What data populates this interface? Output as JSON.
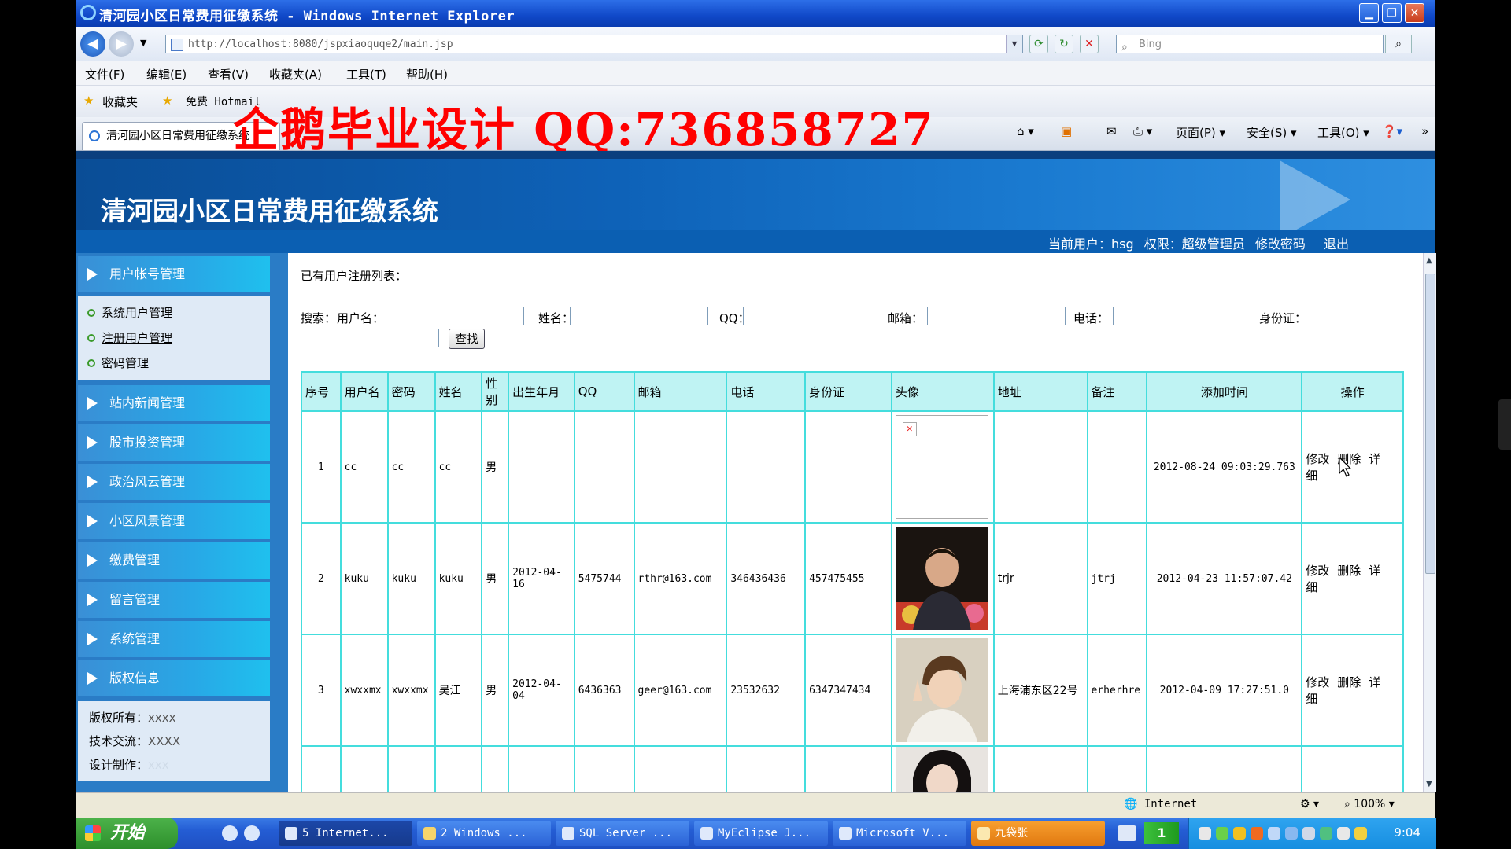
{
  "window": {
    "title": "清河园小区日常费用征缴系统 - Windows Internet Explorer"
  },
  "address": {
    "url": "http://localhost:8080/jspxiaoquqe2/main.jsp",
    "search_placeholder": "Bing"
  },
  "menu": [
    "文件(F)",
    "编辑(E)",
    "查看(V)",
    "收藏夹(A)",
    "工具(T)",
    "帮助(H)"
  ],
  "favbar": {
    "favorites": "收藏夹",
    "free_hotmail": "免费 Hotmail",
    "watermark": "企鹅毕业设计 QQ:736858727"
  },
  "tab": {
    "label": "清河园小区日常费用征缴系统"
  },
  "commandbar": {
    "page": "页面(P)",
    "safety": "安全(S)",
    "tools": "工具(O)"
  },
  "site": {
    "title": "清河园小区日常费用征缴系统",
    "current_user_label": "当前用户：hsg",
    "role_label": "权限：超级管理员",
    "change_password": "修改密码",
    "logout": "退出"
  },
  "sidebar": {
    "first_category": "用户帐号管理",
    "sub_items": [
      "系统用户管理",
      "注册用户管理",
      "密码管理"
    ],
    "categories": [
      "站内新闻管理",
      "股市投资管理",
      "政治风云管理",
      "小区风景管理",
      "缴费管理",
      "留言管理",
      "系统管理",
      "版权信息"
    ],
    "copyright": {
      "owner_label": "版权所有：",
      "owner_value": "xxxx",
      "tech_label": "技术交流：",
      "tech_value": "XXXX",
      "design_label": "设计制作：",
      "design_value": "xxx"
    }
  },
  "content": {
    "list_title": "已有用户注册列表：",
    "search": {
      "prefix": "搜索：",
      "username": "用户名：",
      "name": "姓名：",
      "qq": "QQ：",
      "email": "邮箱：",
      "phone": "电话：",
      "idcard": "身份证：",
      "button": "查找"
    },
    "table": {
      "headers": [
        "序号",
        "用户名",
        "密码",
        "姓名",
        "性别",
        "出生年月",
        "QQ",
        "邮箱",
        "电话",
        "身份证",
        "头像",
        "地址",
        "备注",
        "添加时间",
        "操作"
      ],
      "rows": [
        {
          "no": "1",
          "username": "cc",
          "password": "cc",
          "name": "cc",
          "gender": "男",
          "birth": "",
          "qq": "",
          "email": "",
          "phone": "",
          "idcard": "",
          "address": "",
          "remark": "",
          "added": "2012-08-24 09:03:29.763"
        },
        {
          "no": "2",
          "username": "kuku",
          "password": "kuku",
          "name": "kuku",
          "gender": "男",
          "birth": "2012-04-16",
          "qq": "5475744",
          "email": "rthr@163.com",
          "phone": "346436436",
          "idcard": "457475455",
          "address": "trjr",
          "remark": "jtrj",
          "added": "2012-04-23 11:57:07.42"
        },
        {
          "no": "3",
          "username": "xwxxmx",
          "password": "xwxxmx",
          "name": "吴江",
          "gender": "男",
          "birth": "2012-04-04",
          "qq": "6436363",
          "email": "geer@163.com",
          "phone": "23532632",
          "idcard": "6347347434",
          "address": "上海浦东区22号",
          "remark": "erherhre",
          "added": "2012-04-09 17:27:51.0"
        }
      ],
      "ops": {
        "edit": "修改",
        "delete": "删除",
        "detail": "详细"
      }
    }
  },
  "statusbar": {
    "zone": "Internet",
    "zoom": "100%"
  },
  "taskbar": {
    "start": "开始",
    "tasks": [
      "5 Internet...",
      "2 Windows ...",
      "SQL Server ...",
      "MyEclipse J...",
      "Microsoft V...",
      "九袋张"
    ],
    "badge": "1",
    "clock": "9:04"
  }
}
